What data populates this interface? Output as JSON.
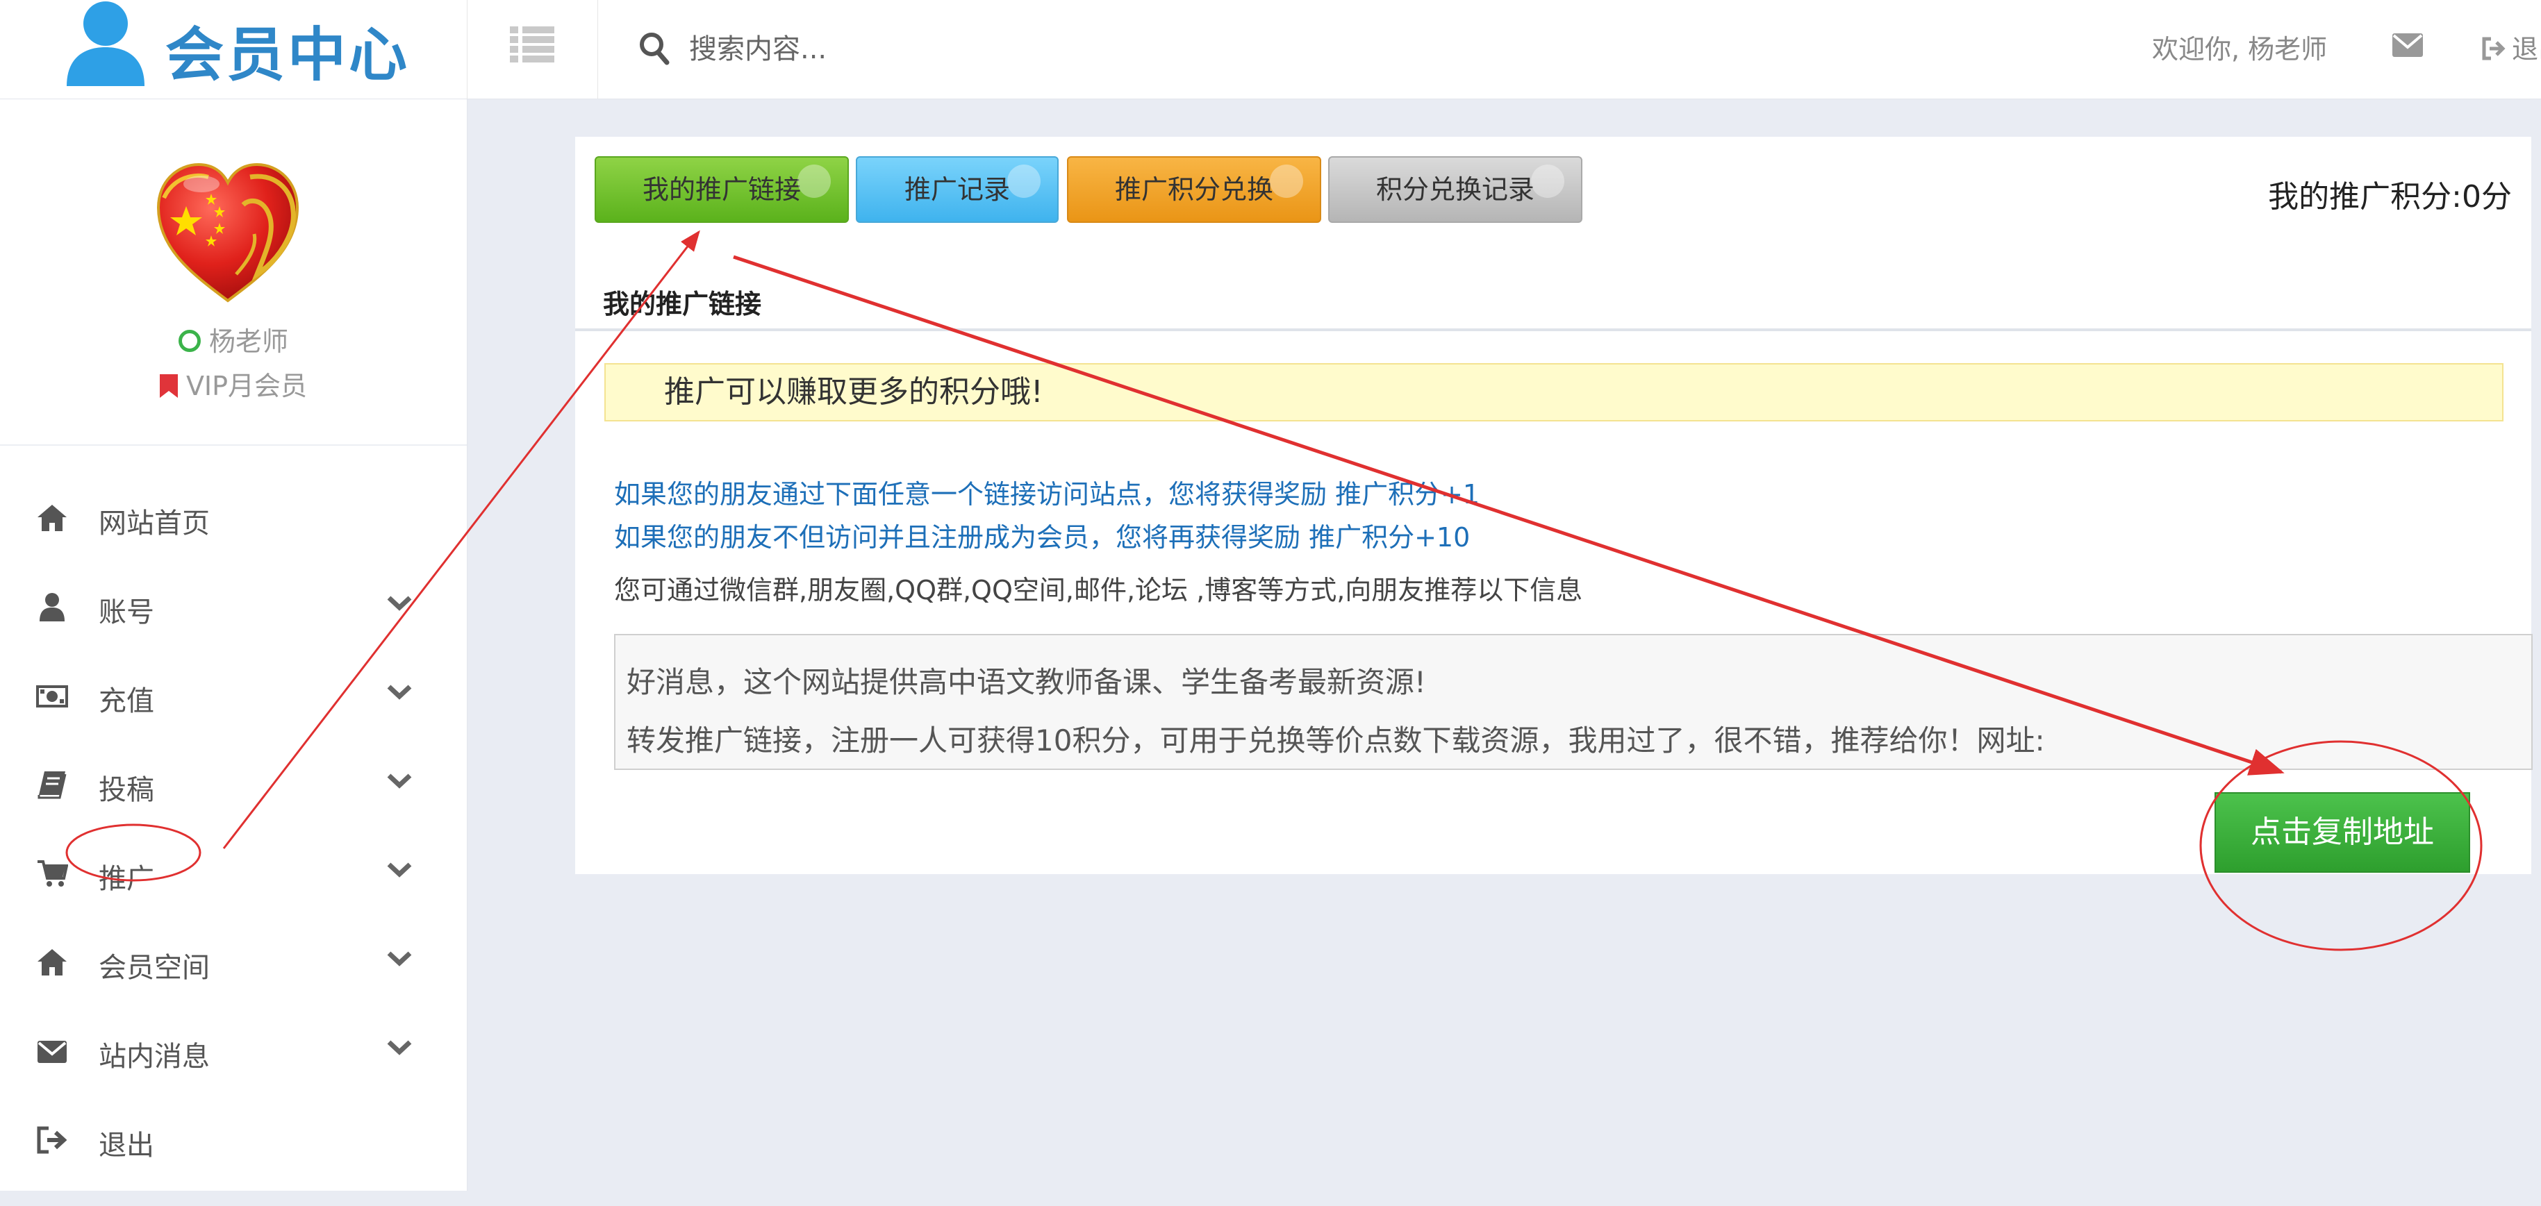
{
  "header": {
    "title": "会员中心",
    "search_placeholder": "搜索内容...",
    "welcome": "欢迎你, 杨老师",
    "logout_label": "退出"
  },
  "user": {
    "name": "杨老师",
    "level": "VIP月会员"
  },
  "sidebar": {
    "items": [
      {
        "label": "网站首页",
        "icon": "home-icon",
        "has_submenu": false
      },
      {
        "label": "账号",
        "icon": "user-icon",
        "has_submenu": true
      },
      {
        "label": "充值",
        "icon": "money-icon",
        "has_submenu": true
      },
      {
        "label": "投稿",
        "icon": "book-icon",
        "has_submenu": true
      },
      {
        "label": "推广",
        "icon": "cart-icon",
        "has_submenu": true
      },
      {
        "label": "会员空间",
        "icon": "home-icon",
        "has_submenu": true
      },
      {
        "label": "站内消息",
        "icon": "envelope-icon",
        "has_submenu": true
      },
      {
        "label": "退出",
        "icon": "sign-out-icon",
        "has_submenu": false
      }
    ]
  },
  "main": {
    "tabs": [
      {
        "label": "我的推广链接",
        "color": "#6cc12a"
      },
      {
        "label": "推广记录",
        "color": "#52c0f4"
      },
      {
        "label": "推广积分兑换",
        "color": "#f0a329"
      },
      {
        "label": "积分兑换记录",
        "color": "#c4c4c4"
      }
    ],
    "points_label": "我的推广积分:0分",
    "section_title": "我的推广链接",
    "notice": "推广可以赚取更多的积分哦!",
    "info_line_1": "如果您的朋友通过下面任意一个链接访问站点，您将获得奖励 推广积分+1",
    "info_line_2": "如果您的朋友不但访问并且注册成为会员，您将再获得奖励 推广积分+10",
    "info_line_3": "您可通过微信群,朋友圈,QQ群,QQ空间,邮件,论坛 ,博客等方式,向朋友推荐以下信息",
    "share_text": "好消息，这个网站提供高中语文教师备课、学生备考最新资源!\n转发推广链接，注册一人可获得10积分，可用于兑换等价点数下载资源，我用过了，很不错，推荐给你！网址:",
    "copy_button": "点击复制地址"
  },
  "colors": {
    "brand": "#2f87c8",
    "annotation": "#e03030"
  }
}
